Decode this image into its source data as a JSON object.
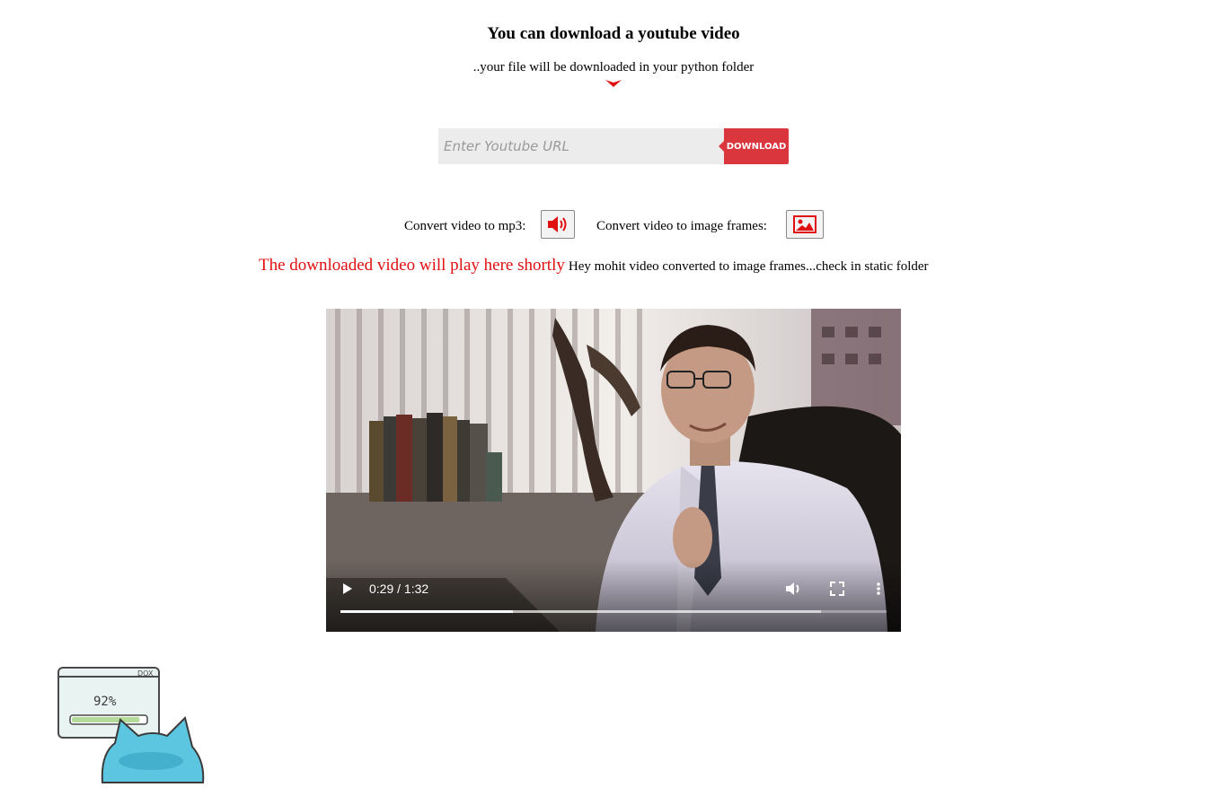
{
  "header": {
    "title": "You can download a youtube video",
    "subtitle": "..your file will be downloaded in your python folder"
  },
  "download_form": {
    "placeholder": "Enter Youtube URL",
    "button_label": "DOWNLOAD"
  },
  "convert": {
    "mp3_label": "Convert video to mp3:",
    "mp3_icon": "volume-icon",
    "frames_label": "Convert video to image frames:",
    "frames_icon": "image-icon"
  },
  "status": {
    "play_message": "The downloaded video will play here shortly",
    "frames_message": "Hey mohit video converted to image frames...check in static folder"
  },
  "video_player": {
    "time_display": "0:29 / 1:32",
    "progress_fraction": 0.3152,
    "buffered_fraction": 0.88
  },
  "mascot": {
    "progress_text": "92%",
    "progress_fraction": 0.92,
    "window_label": "DOX"
  },
  "colors": {
    "accent_red": "#d9363e",
    "message_red": "#e01010",
    "input_bg": "#ececec",
    "mascot_blue": "#5cc6e0"
  }
}
